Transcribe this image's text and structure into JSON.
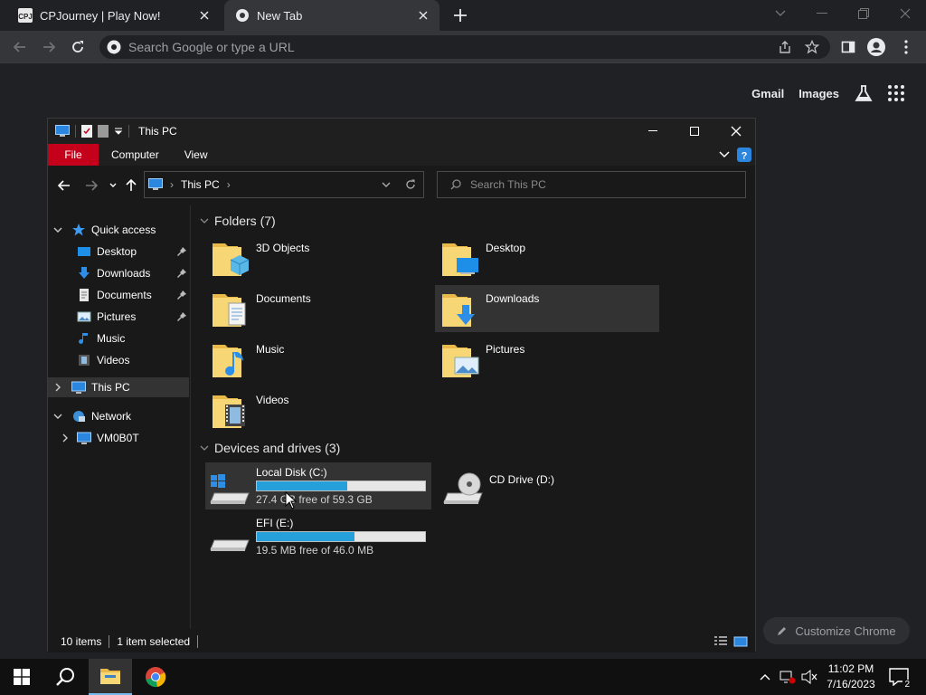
{
  "chrome": {
    "tabs": [
      {
        "title": "CPJourney | Play Now!"
      },
      {
        "title": "New Tab"
      }
    ],
    "omnibox_placeholder": "Search Google or type a URL",
    "ntp": {
      "gmail": "Gmail",
      "images": "Images",
      "customize": "Customize Chrome"
    }
  },
  "explorer": {
    "title": "This PC",
    "ribbon": {
      "file": "File",
      "computer": "Computer",
      "view": "View"
    },
    "address": "This PC",
    "search_placeholder": "Search This PC",
    "nav": {
      "quick_access": "Quick access",
      "items": [
        "Desktop",
        "Downloads",
        "Documents",
        "Pictures",
        "Music",
        "Videos"
      ],
      "this_pc": "This PC",
      "network": "Network",
      "network_child": "VM0B0T"
    },
    "folders_header": "Folders (7)",
    "folders": [
      "3D Objects",
      "Desktop",
      "Documents",
      "Downloads",
      "Music",
      "Pictures",
      "Videos"
    ],
    "devices_header": "Devices and drives (3)",
    "drives": [
      {
        "name": "Local Disk (C:)",
        "free": "27.4 GB free of 59.3 GB",
        "used_fraction": 0.54
      },
      {
        "name": "CD Drive (D:)"
      },
      {
        "name": "EFI (E:)",
        "free": "19.5 MB free of 46.0 MB",
        "used_fraction": 0.58
      }
    ],
    "status": {
      "items": "10 items",
      "selected": "1 item selected"
    }
  },
  "taskbar": {
    "time": "11:02 PM",
    "date": "7/16/2023",
    "notifications": "2"
  },
  "colors": {
    "accent_red": "#c4001a",
    "drive_bar": "#26a0da"
  }
}
